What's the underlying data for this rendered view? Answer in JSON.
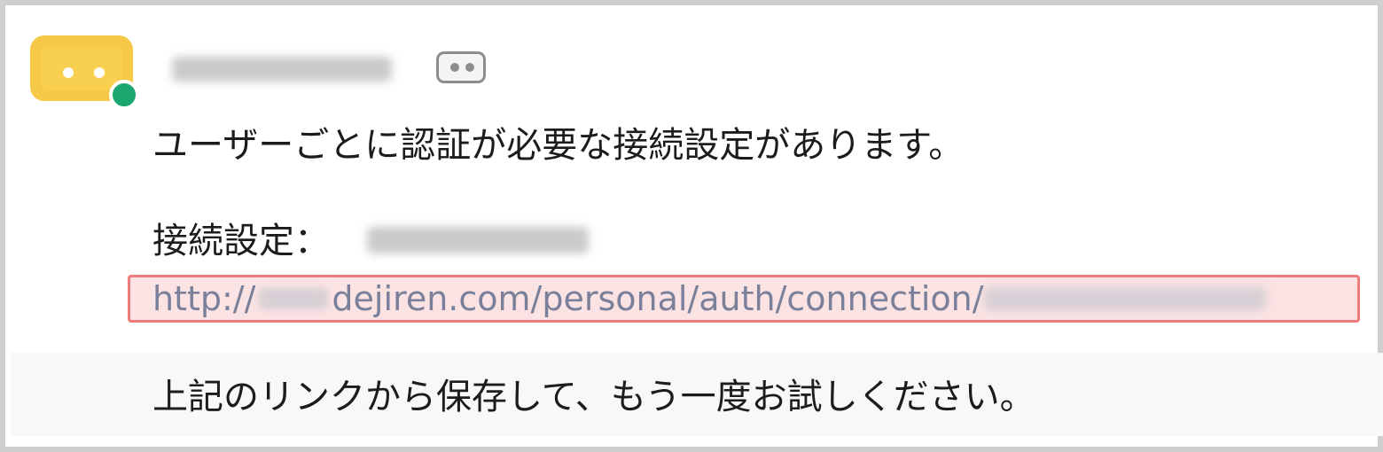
{
  "message": {
    "avatar": {
      "icon": "bot-face-icon",
      "color": "#f7c948",
      "presence_color": "#1aa66e"
    },
    "sender_badge_icon": "bot-badge-icon",
    "line1": "ユーザーごとに認証が必要な接続設定があります。",
    "connection_label": "接続設定：",
    "link": {
      "prefix": "http://",
      "path": "dejiren.com/personal/auth/connection/"
    },
    "line3": "上記のリンクから保存して、もう一度お試しください。"
  },
  "colors": {
    "highlight_border": "#f07b7b",
    "highlight_fill": "#fbe3e3",
    "link_text": "#7a809a"
  }
}
